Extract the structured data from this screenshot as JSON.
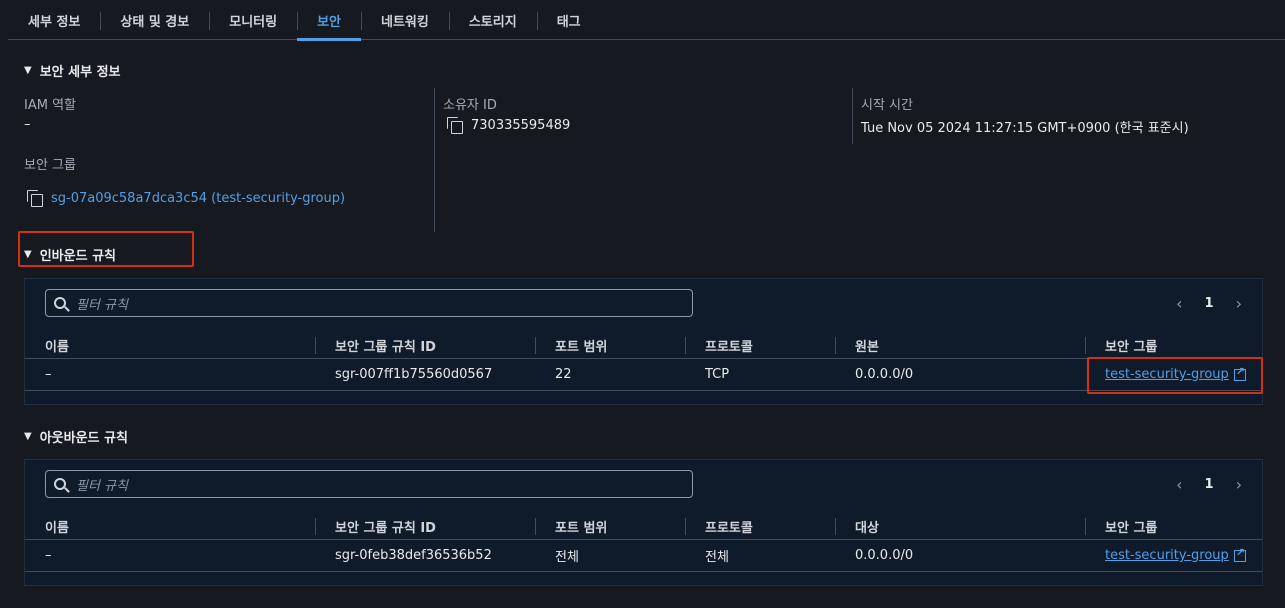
{
  "tabs": [
    "세부 정보",
    "상태 및 경보",
    "모니터링",
    "보안",
    "네트워킹",
    "스토리지",
    "태그"
  ],
  "active_tab": "보안",
  "security_details": {
    "title": "보안 세부 정보",
    "iam_role_label": "IAM 역할",
    "iam_role_value": "–",
    "owner_id_label": "소유자 ID",
    "owner_id_value": "730335595489",
    "start_time_label": "시작 시간",
    "start_time_value": "Tue Nov 05 2024 11:27:15 GMT+0900 (한국 표준시)",
    "security_group_label": "보안 그룹",
    "security_group_value": "sg-07a09c58a7dca3c54 (test-security-group)"
  },
  "inbound": {
    "title": "인바운드 규칙",
    "search_placeholder": "필터 규칙",
    "page": "1",
    "columns": [
      "이름",
      "보안 그룹 규칙 ID",
      "포트 범위",
      "프로토콜",
      "원본",
      "보안 그룹"
    ],
    "rows": [
      {
        "name": "–",
        "rule_id": "sgr-007ff1b75560d0567",
        "port": "22",
        "protocol": "TCP",
        "source": "0.0.0.0/0",
        "group": "test-security-group"
      }
    ]
  },
  "outbound": {
    "title": "아웃바운드 규칙",
    "search_placeholder": "필터 규칙",
    "page": "1",
    "columns": [
      "이름",
      "보안 그룹 규칙 ID",
      "포트 범위",
      "프로토콜",
      "대상",
      "보안 그룹"
    ],
    "rows": [
      {
        "name": "–",
        "rule_id": "sgr-0feb38def36536b52",
        "port": "전체",
        "protocol": "전체",
        "dest": "0.0.0.0/0",
        "group": "test-security-group"
      }
    ]
  },
  "colors": {
    "accent": "#539fe5",
    "highlight": "#d13212",
    "background": "#16191f"
  }
}
